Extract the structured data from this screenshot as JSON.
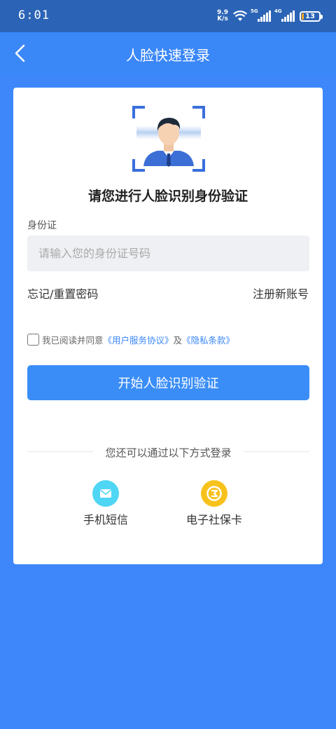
{
  "status_bar": {
    "time": "6:01",
    "net_speed_value": "9.9",
    "net_speed_unit": "K/s",
    "signal_labels": [
      "5G",
      "4G"
    ],
    "battery": "13",
    "battery_level": 0.13,
    "battery_color": "#f5a623"
  },
  "header": {
    "title": "人脸快速登录",
    "back_icon": "chevron-left-icon",
    "background": "#3a87f8"
  },
  "card": {
    "illustration_icon": "face-scan-icon",
    "title": "请您进行人脸识别身份验证",
    "id_label": "身份证",
    "id_placeholder": "请输入您的身份证号码",
    "id_value": "",
    "forgot_link": "忘记/重置密码",
    "register_link": "注册新账号",
    "agreement": {
      "checked": false,
      "prefix": "我已阅读并同意",
      "service_link": "《用户服务协议》",
      "conjunction": "及",
      "privacy_link": "《隐私条款》"
    },
    "start_button": "开始人脸识别验证",
    "alt_divider": "您还可以通过以下方式登录",
    "alt_methods": [
      {
        "label": "手机短信",
        "icon": "envelope-icon",
        "color": "#4fd6f4"
      },
      {
        "label": "电子社保卡",
        "icon": "social-security-card-icon",
        "color": "#f8c21c"
      }
    ]
  },
  "colors": {
    "page_background": "#3d87fb",
    "accent": "#3a8df6",
    "link": "#3a87f8"
  }
}
